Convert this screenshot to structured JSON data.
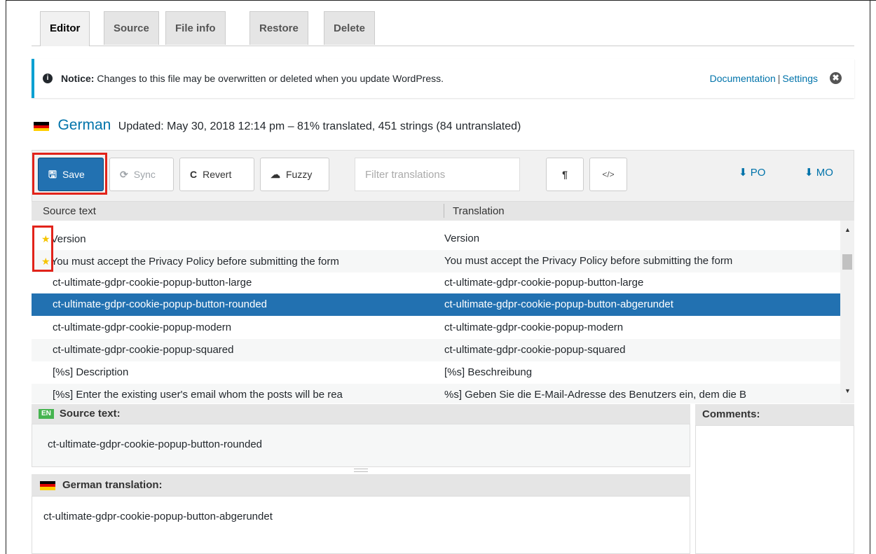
{
  "tabs": [
    {
      "label": "Editor",
      "active": true
    },
    {
      "label": "Source"
    },
    {
      "label": "File info"
    },
    {
      "label": "Restore"
    },
    {
      "label": "Delete"
    }
  ],
  "notice": {
    "icon": "info-circle-icon",
    "label": "Notice:",
    "message": "Changes to this file may be overwritten or deleted when you update WordPress.",
    "link_documentation": "Documentation",
    "separator": "|",
    "link_settings": "Settings",
    "close_icon": "✖"
  },
  "heading": {
    "flag_colors": [
      "#000000",
      "#dd0000",
      "#ffce00"
    ],
    "language": "German",
    "status": "Updated: May 30, 2018 12:14 pm – 81% translated, 451 strings (84 untranslated)"
  },
  "toolbar": {
    "save": {
      "icon": "🖫",
      "label": "Save"
    },
    "sync": {
      "icon": "⟳",
      "label": "Sync"
    },
    "revert": {
      "icon": "C",
      "label": "Revert"
    },
    "fuzzy": {
      "icon": "☁",
      "label": "Fuzzy"
    },
    "filter_placeholder": "Filter translations",
    "pilcrow": "¶",
    "code": "</>",
    "download_po": "PO",
    "download_mo": "MO",
    "download_icon": "⬇"
  },
  "grid": {
    "col_source": "Source text",
    "col_translation": "Translation",
    "rows": [
      {
        "source": "Version",
        "translation": "Version",
        "starred": true
      },
      {
        "source": "You must accept the Privacy Policy before submitting the form",
        "translation": "You must accept the Privacy Policy before submitting the form",
        "starred": true
      },
      {
        "source": "ct-ultimate-gdpr-cookie-popup-button-large",
        "translation": "ct-ultimate-gdpr-cookie-popup-button-large"
      },
      {
        "source": "ct-ultimate-gdpr-cookie-popup-button-rounded",
        "translation": "ct-ultimate-gdpr-cookie-popup-button-abgerundet",
        "selected": true
      },
      {
        "source": "ct-ultimate-gdpr-cookie-popup-modern",
        "translation": "ct-ultimate-gdpr-cookie-popup-modern"
      },
      {
        "source": "ct-ultimate-gdpr-cookie-popup-squared",
        "translation": "ct-ultimate-gdpr-cookie-popup-squared"
      },
      {
        "source": "[%s] Description",
        "translation": "[%s] Beschreibung"
      },
      {
        "source": "[%s] Enter the existing user's email whom the posts will be rea",
        "translation": "%s] Geben Sie die E-Mail-Adresse des Benutzers ein, dem die B"
      }
    ]
  },
  "editor": {
    "source_badge": "EN",
    "source_label": "Source text:",
    "source_value": "ct-ultimate-gdpr-cookie-popup-button-rounded",
    "translation_label": "German translation:",
    "translation_value": "ct-ultimate-gdpr-cookie-popup-button-abgerundet",
    "comments_label": "Comments:"
  }
}
